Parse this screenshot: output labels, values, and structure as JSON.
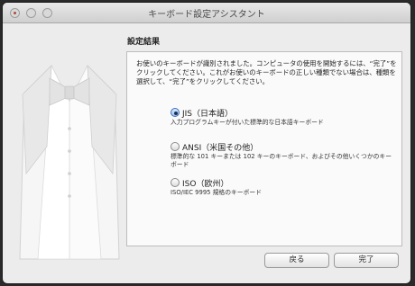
{
  "window": {
    "title": "キーボード設定アシスタント"
  },
  "section": {
    "heading": "設定結果"
  },
  "intro": "お使いのキーボードが識別されました。コンピュータの使用を開始するには、“完了”をクリックしてください。これがお使いのキーボードの正しい種類でない場合は、種類を選択して、“完了”をクリックしてください。",
  "options": [
    {
      "label": "JIS（日本語）",
      "description": "入力プログラムキーが付いた標準的な日本語キーボード",
      "selected": true
    },
    {
      "label": "ANSI（米国その他）",
      "description": "標準的な 101 キーまたは 102 キーのキーボード、およびその他いくつかのキーボード",
      "selected": false
    },
    {
      "label": "ISO（欧州）",
      "description": "ISO/IEC 9995 規格のキーボード",
      "selected": false
    }
  ],
  "buttons": {
    "back": "戻る",
    "done": "完了"
  }
}
